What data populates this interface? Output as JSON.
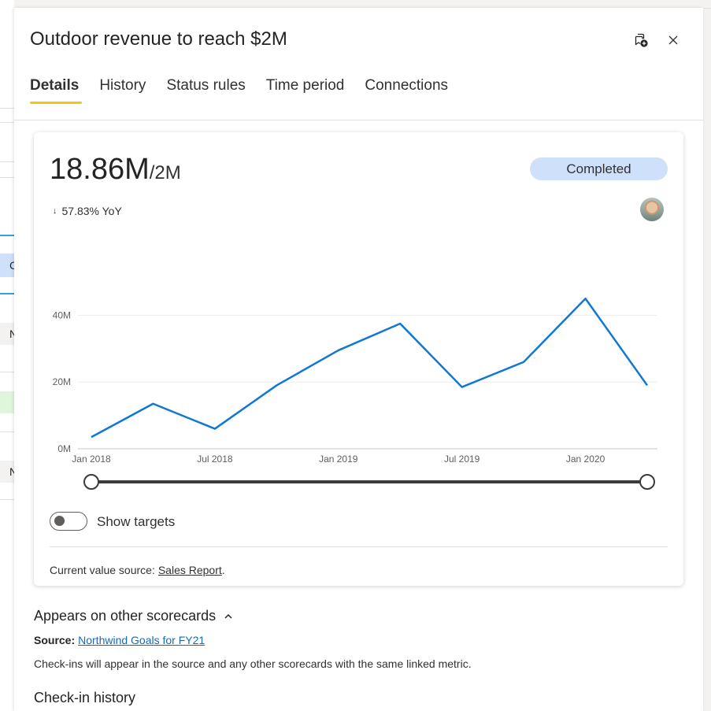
{
  "background": {
    "cells": [
      "C",
      "N",
      "N"
    ]
  },
  "panel": {
    "title": "Outdoor revenue to reach $2M",
    "tabs": [
      {
        "label": "Details",
        "active": true
      },
      {
        "label": "History",
        "active": false
      },
      {
        "label": "Status rules",
        "active": false
      },
      {
        "label": "Time period",
        "active": false
      },
      {
        "label": "Connections",
        "active": false
      }
    ],
    "icons": {
      "follow": "follow-add-icon",
      "close": "close-icon"
    }
  },
  "card": {
    "value": "18.86M",
    "target": "/2M",
    "status": "Completed",
    "status_color": "#cfe0fb",
    "yoy_arrow": "↓",
    "yoy": "57.83% YoY",
    "show_targets_label": "Show targets",
    "show_targets_on": false,
    "source_label": "Current value source:",
    "source_link": "Sales Report",
    "source_suffix": "."
  },
  "chart_data": {
    "type": "line",
    "x": [
      "Jan 2018",
      "Apr 2018",
      "Jul 2018",
      "Oct 2018",
      "Jan 2019",
      "Apr 2019",
      "Jul 2019",
      "Oct 2019",
      "Jan 2020",
      "Apr 2020"
    ],
    "x_tick_labels": [
      "Jan 2018",
      "Jul 2018",
      "Jan 2019",
      "Jul 2019",
      "Jan 2020"
    ],
    "series": [
      {
        "values": [
          3.5,
          13.5,
          6,
          19,
          29.5,
          37.5,
          18.5,
          26,
          45,
          19
        ],
        "color": "#0f78d4"
      }
    ],
    "y_tick_labels": [
      "0M",
      "20M",
      "40M"
    ],
    "y_ticks": [
      0,
      20,
      40
    ],
    "ylim": [
      0,
      50
    ],
    "grid": true
  },
  "appears": {
    "title": "Appears on other scorecards",
    "source_label": "Source:",
    "source_link": "Northwind Goals for FY21",
    "note": "Check-ins will appear in the source and any other scorecards with the same linked metric."
  },
  "checkin": {
    "title": "Check-in history"
  }
}
